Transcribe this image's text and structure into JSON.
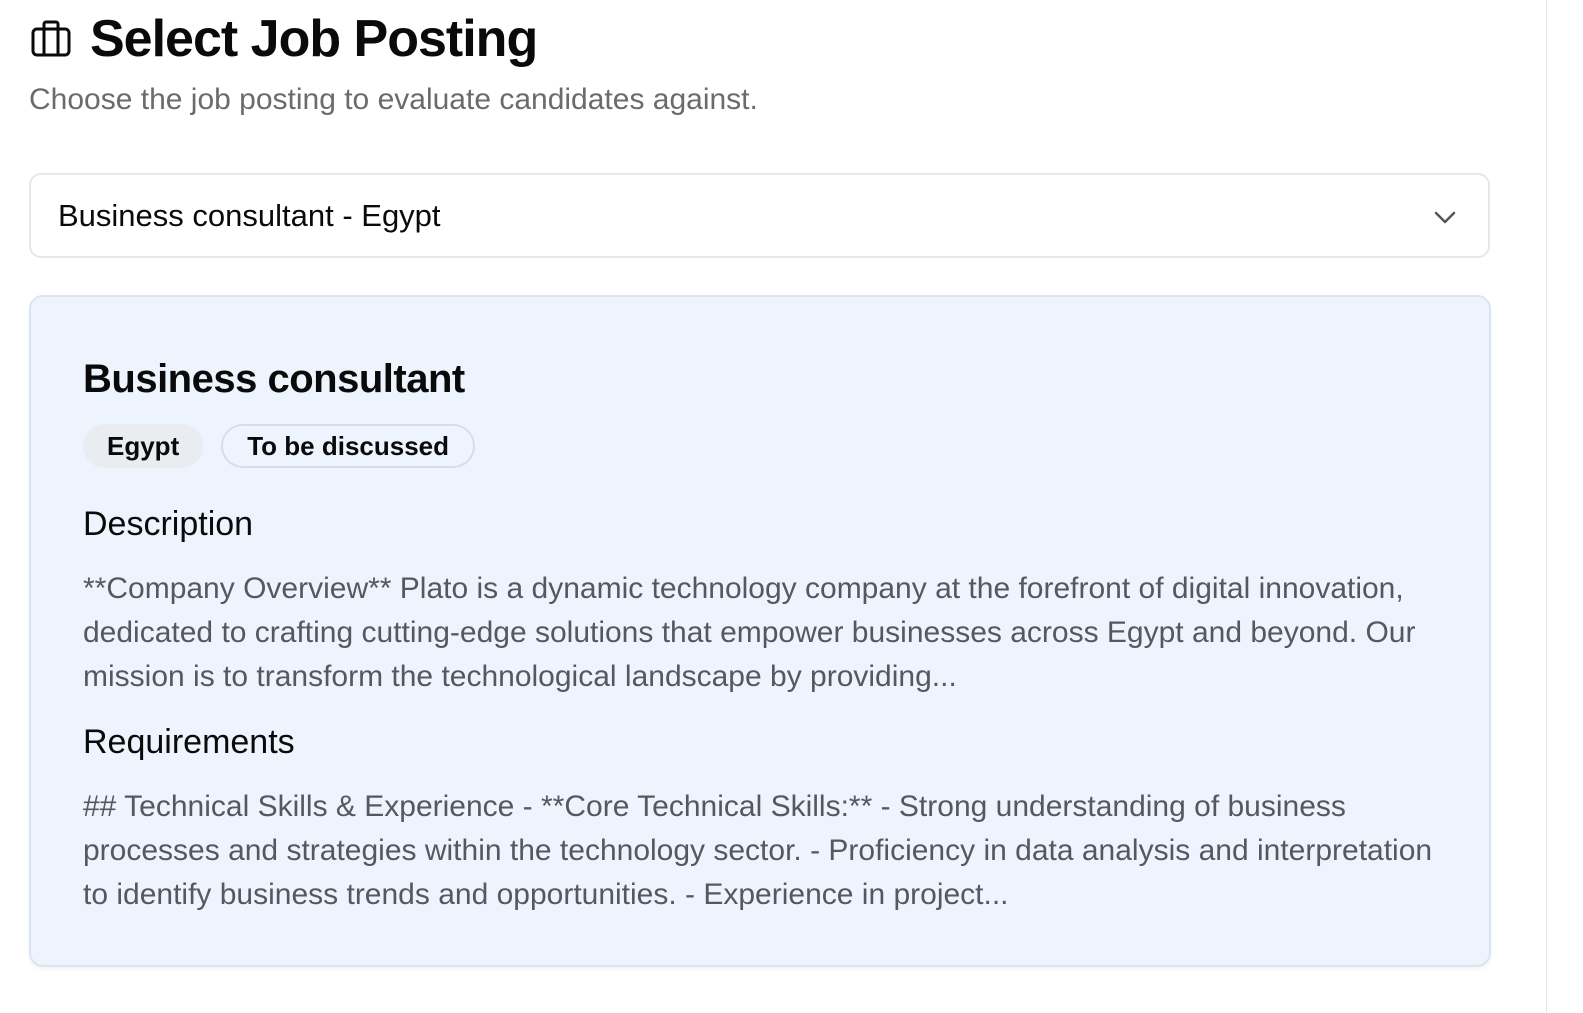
{
  "header": {
    "title": "Select Job Posting",
    "subtitle": "Choose the job posting to evaluate candidates against.",
    "icon": "briefcase-icon"
  },
  "job_select": {
    "selected_value": "Business consultant - Egypt",
    "icon": "chevron-down-icon"
  },
  "job_card": {
    "title": "Business consultant",
    "badges": {
      "location": "Egypt",
      "salary": "To be discussed"
    },
    "description_heading": "Description",
    "description_text": "**Company Overview** Plato is a dynamic technology company at the forefront of digital innovation, dedicated to crafting cutting-edge solutions that empower businesses across Egypt and beyond. Our mission is to transform the technological landscape by providing...",
    "requirements_heading": "Requirements",
    "requirements_text": "## Technical Skills & Experience - **Core Technical Skills:** - Strong understanding of business processes and strategies within the technology sector. - Proficiency in data analysis and interpretation to identify business trends and opportunities. - Experience in project..."
  },
  "colors": {
    "card_background": "#eef4fd",
    "subtitle_text": "#6b6b6b",
    "body_text": "#55595f",
    "border": "#e5e7eb"
  }
}
